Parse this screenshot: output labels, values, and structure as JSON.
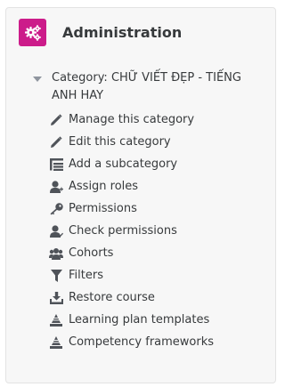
{
  "block": {
    "title": "Administration",
    "accent_color": "#cc1c8a",
    "icon": "cogs-icon"
  },
  "category": {
    "label": "Category: CHỮ VIẾT ĐẸP - TIẾNG ANH HAY",
    "expanded": true
  },
  "items": [
    {
      "label": "Manage this category",
      "icon": "pencil-icon"
    },
    {
      "label": "Edit this category",
      "icon": "pencil-icon"
    },
    {
      "label": "Add a subcategory",
      "icon": "sitemap-icon"
    },
    {
      "label": "Assign roles",
      "icon": "user-plus-icon"
    },
    {
      "label": "Permissions",
      "icon": "key-icon"
    },
    {
      "label": "Check permissions",
      "icon": "user-check-icon"
    },
    {
      "label": "Cohorts",
      "icon": "users-icon"
    },
    {
      "label": "Filters",
      "icon": "filter-icon"
    },
    {
      "label": "Restore course",
      "icon": "upload-icon"
    },
    {
      "label": "Learning plan templates",
      "icon": "triangle-stack-icon"
    },
    {
      "label": "Competency frameworks",
      "icon": "triangle-stack-icon"
    }
  ],
  "colors": {
    "icon": "#4f5359",
    "text": "#373a3c"
  }
}
